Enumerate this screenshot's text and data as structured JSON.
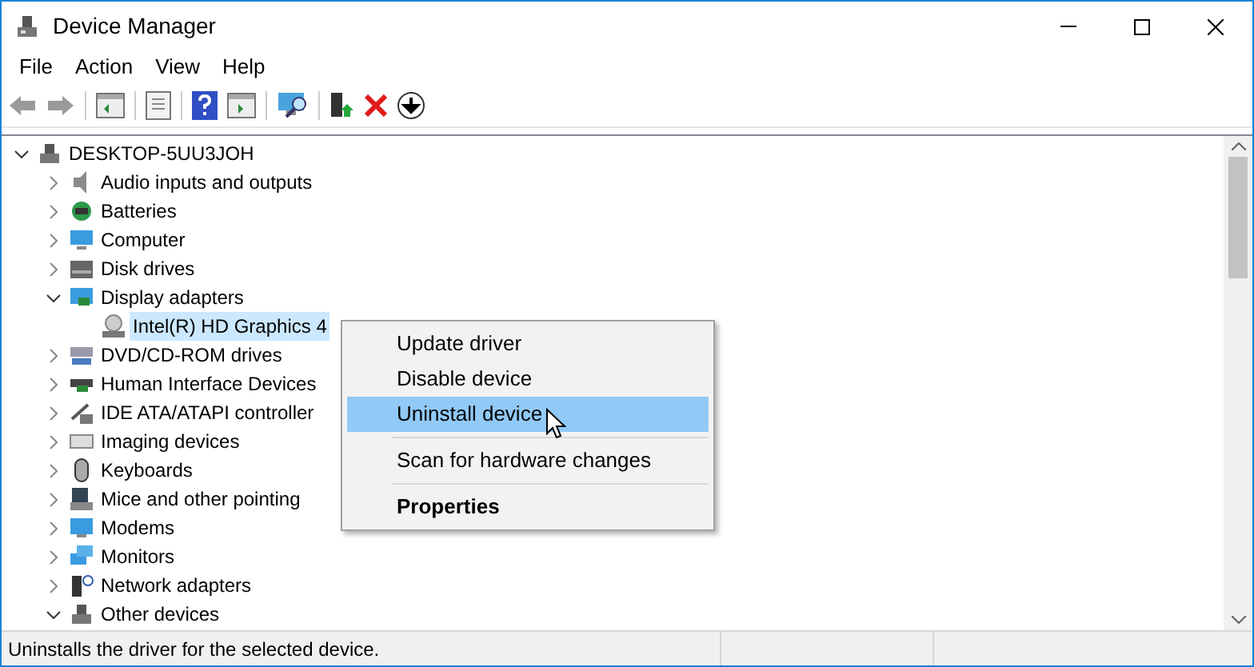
{
  "window": {
    "title": "Device Manager"
  },
  "menu_bar": [
    "File",
    "Action",
    "View",
    "Help"
  ],
  "tree": {
    "label": "DESKTOP-5UU3JOH",
    "expanded": true,
    "selected": false,
    "children": [
      {
        "label": "Audio inputs and outputs",
        "expanded": false,
        "selected": false
      },
      {
        "label": "Batteries",
        "expanded": false,
        "selected": false
      },
      {
        "label": "Computer",
        "expanded": false,
        "selected": false
      },
      {
        "label": "Disk drives",
        "expanded": false,
        "selected": false
      },
      {
        "label": "Display adapters",
        "expanded": true,
        "selected": false,
        "children": [
          {
            "label": "Intel(R) HD Graphics 4",
            "selected": true
          }
        ]
      },
      {
        "label": "DVD/CD-ROM drives",
        "expanded": false,
        "selected": false
      },
      {
        "label": "Human Interface Devices",
        "expanded": false,
        "selected": false
      },
      {
        "label": "IDE ATA/ATAPI controller",
        "expanded": false,
        "selected": false
      },
      {
        "label": "Imaging devices",
        "expanded": false,
        "selected": false
      },
      {
        "label": "Keyboards",
        "expanded": false,
        "selected": false
      },
      {
        "label": "Mice and other pointing",
        "expanded": false,
        "selected": false
      },
      {
        "label": "Modems",
        "expanded": false,
        "selected": false
      },
      {
        "label": "Monitors",
        "expanded": false,
        "selected": false
      },
      {
        "label": "Network adapters",
        "expanded": false,
        "selected": false
      },
      {
        "label": "Other devices",
        "expanded": true,
        "selected": false
      }
    ]
  },
  "context_menu": [
    {
      "label": "Update driver",
      "selected": false,
      "bold": false,
      "separator_after": false
    },
    {
      "label": "Disable device",
      "selected": false,
      "bold": false,
      "separator_after": false
    },
    {
      "label": "Uninstall device",
      "selected": true,
      "bold": false,
      "separator_after": true
    },
    {
      "label": "Scan for hardware changes",
      "selected": false,
      "bold": false,
      "separator_after": true
    },
    {
      "label": "Properties",
      "selected": false,
      "bold": true,
      "separator_after": false
    }
  ],
  "status_bar": "Uninstalls the driver for the selected device."
}
